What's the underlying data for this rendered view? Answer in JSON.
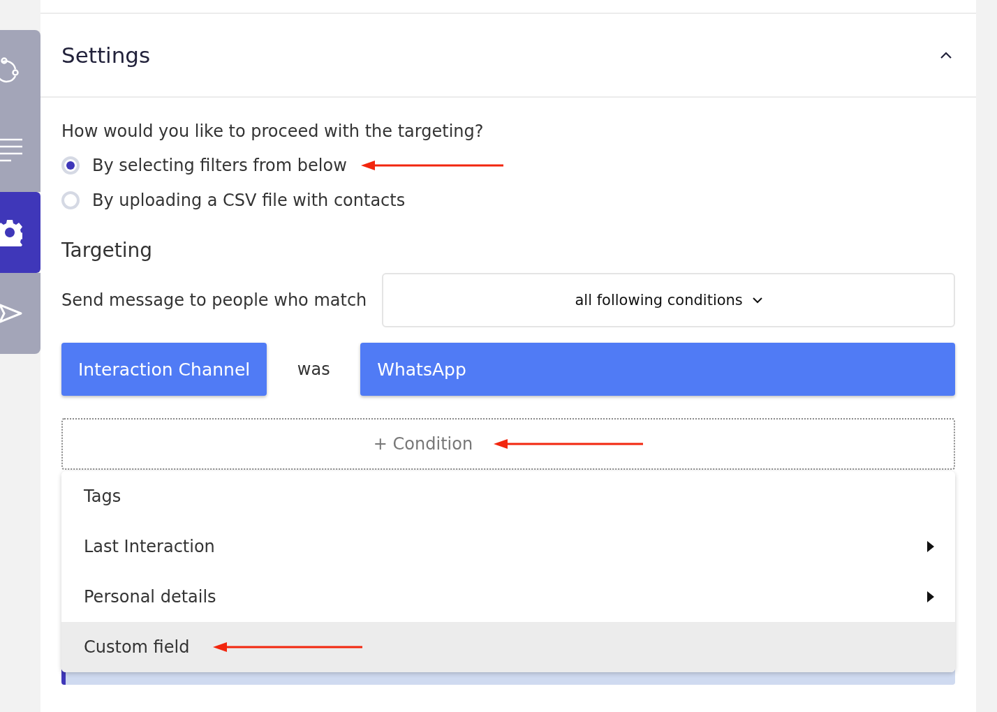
{
  "sidebar": {
    "items": [
      {
        "kind": "flow",
        "selected": false
      },
      {
        "kind": "list",
        "selected": false
      },
      {
        "kind": "gear",
        "selected": true
      },
      {
        "kind": "send",
        "selected": false
      }
    ]
  },
  "settings": {
    "title": "Settings",
    "expanded": true,
    "question": "How would you like to proceed with the targeting?",
    "options": [
      {
        "label": "By selecting filters from below",
        "selected": true,
        "annotated": true
      },
      {
        "label": "By uploading a CSV file with contacts",
        "selected": false,
        "annotated": false
      }
    ],
    "targeting": {
      "title": "Targeting",
      "match_label": "Send message to people who match",
      "match_value": "all following conditions",
      "condition": {
        "field": "Interaction Channel",
        "operator": "was",
        "value": "WhatsApp"
      },
      "add_condition": {
        "label": "+ Condition",
        "annotated": true
      },
      "menu": [
        {
          "label": "Tags",
          "submenu": false,
          "highlighted": false,
          "annotated": false
        },
        {
          "label": "Last Interaction",
          "submenu": true,
          "highlighted": false,
          "annotated": false
        },
        {
          "label": "Personal details",
          "submenu": true,
          "highlighted": false,
          "annotated": false
        },
        {
          "label": "Custom field",
          "submenu": false,
          "highlighted": true,
          "annotated": true
        }
      ]
    }
  }
}
